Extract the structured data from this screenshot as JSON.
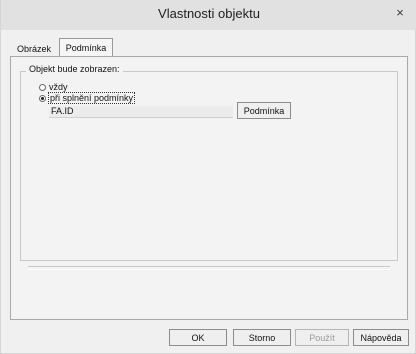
{
  "window": {
    "title": "Vlastnosti objektu",
    "close_glyph": "×"
  },
  "tabs": [
    {
      "label": "Obrázek",
      "active": false
    },
    {
      "label": "Podmínka",
      "active": true
    }
  ],
  "group": {
    "title": "Objekt bude zobrazen:",
    "options": [
      {
        "label": "vždy",
        "selected": false
      },
      {
        "label": "při splnění podmínky",
        "selected": true
      }
    ],
    "condition_value": "FA.ID",
    "condition_button": "Podmínka"
  },
  "footer": {
    "ok": "OK",
    "cancel": "Storno",
    "apply": "Použít",
    "help": "Nápověda"
  },
  "colors": {
    "titlebar": "#e1e1e1",
    "dialog_bg": "#f0f0f0"
  },
  "icons": {
    "close": "close-icon"
  }
}
